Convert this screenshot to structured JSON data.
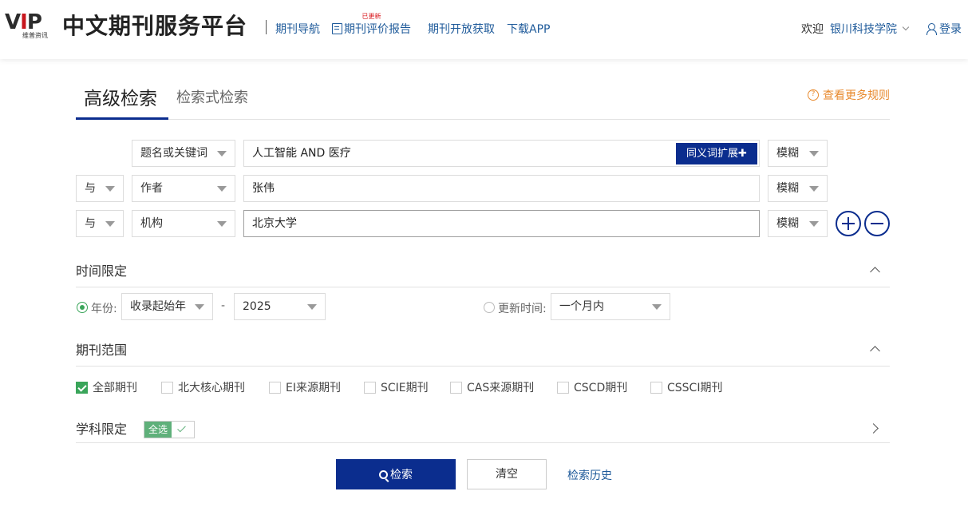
{
  "header": {
    "logo_mark_left": "V",
    "logo_mark_red": "I",
    "logo_mark_right": "P",
    "logo_sub": "维普资讯",
    "title": "中文期刊服务平台",
    "nav": [
      {
        "label": "期刊导航"
      },
      {
        "label": "期刊评价报告",
        "badge": "已更新"
      },
      {
        "label": "期刊开放获取"
      },
      {
        "label": "下载APP"
      }
    ],
    "welcome": "欢迎",
    "org": "银川科技学院",
    "login": "登录"
  },
  "tabs": {
    "advanced": "高级检索",
    "expression": "检索式检索",
    "more_rules": "查看更多规则"
  },
  "search_rows": [
    {
      "field": "题名或关键词",
      "value": "人工智能 AND 医疗",
      "match": "模糊"
    },
    {
      "logic": "与",
      "field": "作者",
      "value": "张伟",
      "match": "模糊"
    },
    {
      "logic": "与",
      "field": "机构",
      "value": "北京大学",
      "match": "模糊"
    }
  ],
  "synonym_button": "同义词扩展✚",
  "time": {
    "heading": "时间限定",
    "year_label": "年份:",
    "start_year": "收录起始年",
    "dash": "-",
    "end_year": "2025",
    "update_label": "更新时间:",
    "update_value": "一个月内"
  },
  "journal_scope": {
    "heading": "期刊范围",
    "options": [
      {
        "label": "全部期刊",
        "checked": true
      },
      {
        "label": "北大核心期刊",
        "checked": false
      },
      {
        "label": "EI来源期刊",
        "checked": false
      },
      {
        "label": "SCIE期刊",
        "checked": false
      },
      {
        "label": "CAS来源期刊",
        "checked": false
      },
      {
        "label": "CSCD期刊",
        "checked": false
      },
      {
        "label": "CSSCI期刊",
        "checked": false
      }
    ]
  },
  "subject": {
    "heading": "学科限定",
    "select_all": "全选"
  },
  "actions": {
    "search": "检索",
    "clear": "清空",
    "history": "检索历史"
  },
  "colors": {
    "primary": "#0b2d8e",
    "link": "#1e5a9a",
    "accent_orange": "#e88a2e",
    "check_green": "#3aa55a",
    "logo_red": "#c8161d"
  }
}
